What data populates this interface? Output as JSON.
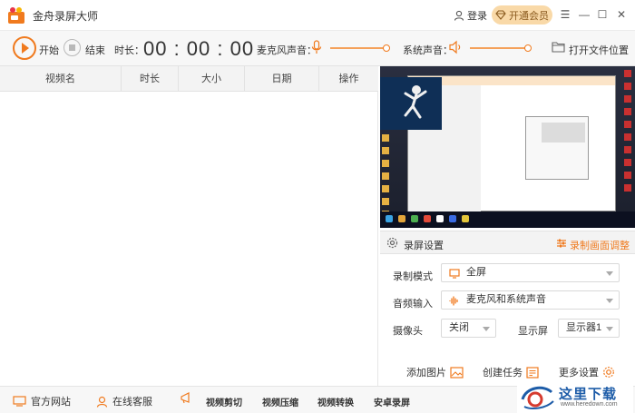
{
  "app": {
    "title": "金舟录屏大师",
    "login": "登录",
    "vip": "开通会员"
  },
  "window_controls": {
    "menu": "☰",
    "minimize": "—",
    "maximize": "☐",
    "close": "✕"
  },
  "toolbar": {
    "start": "开始",
    "stop": "结束",
    "duration_label": "时长：",
    "timer": "00 : 00 : 00",
    "mic_label": "麦克风声音：",
    "mic_level": 1.0,
    "sys_label": "系统声音：",
    "sys_level": 1.0,
    "open_folder": "打开文件位置"
  },
  "table": {
    "columns": [
      "视频名",
      "时长",
      "大小",
      "日期",
      "操作"
    ],
    "rows": []
  },
  "settings": {
    "title": "录屏设置",
    "adjust": "录制画面调整",
    "mode_label": "录制模式",
    "mode_value": "全屏",
    "audio_label": "音频输入",
    "audio_value": "麦克风和系统声音",
    "camera_label": "摄像头",
    "camera_value": "关闭",
    "display_label": "显示屏",
    "display_value": "显示器1",
    "add_image": "添加图片",
    "create_task": "创建任务",
    "more_settings": "更多设置"
  },
  "footer": {
    "website": "官方网站",
    "support": "在线客服",
    "tools": [
      "视频剪切",
      "视频压缩",
      "视频转换",
      "安卓录屏"
    ]
  },
  "watermark": {
    "text": "这里下载",
    "url": "www.heredown.com"
  },
  "colors": {
    "accent": "#f07a1e",
    "vip_bg": "#f9d9a8",
    "watermark": "#1d5ca8"
  }
}
